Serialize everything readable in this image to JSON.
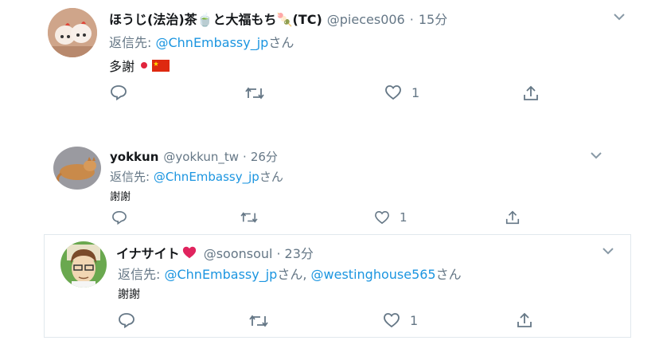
{
  "tweets": [
    {
      "name": "ほうじ(法治)茶🍵と大福もち🍡(TC)",
      "handle": "@pieces006",
      "dot": "·",
      "time": "15分",
      "reply_prefix": "返信先: ",
      "mentions": [
        "@ChnEmbassy_jp"
      ],
      "reply_suffix": "さん",
      "text": "多謝",
      "like_count": "1"
    },
    {
      "name": "yokkun",
      "handle": "@yokkun_tw",
      "dot": "·",
      "time": "26分",
      "reply_prefix": "返信先: ",
      "mentions": [
        "@ChnEmbassy_jp"
      ],
      "reply_suffix": "さん",
      "text": "謝謝",
      "like_count": "1"
    },
    {
      "name": "イナサイト",
      "handle": "@soonsoul",
      "dot": "·",
      "time": "23分",
      "reply_prefix": "返信先: ",
      "mentions": [
        "@ChnEmbassy_jp",
        "@westinghouse565"
      ],
      "mention_joiner": "さん, ",
      "reply_suffix": "さん",
      "text": "謝謝",
      "like_count": "1"
    }
  ],
  "colors": {
    "link": "#1b95e0",
    "muted": "#657786",
    "heart": "#e0245e"
  }
}
